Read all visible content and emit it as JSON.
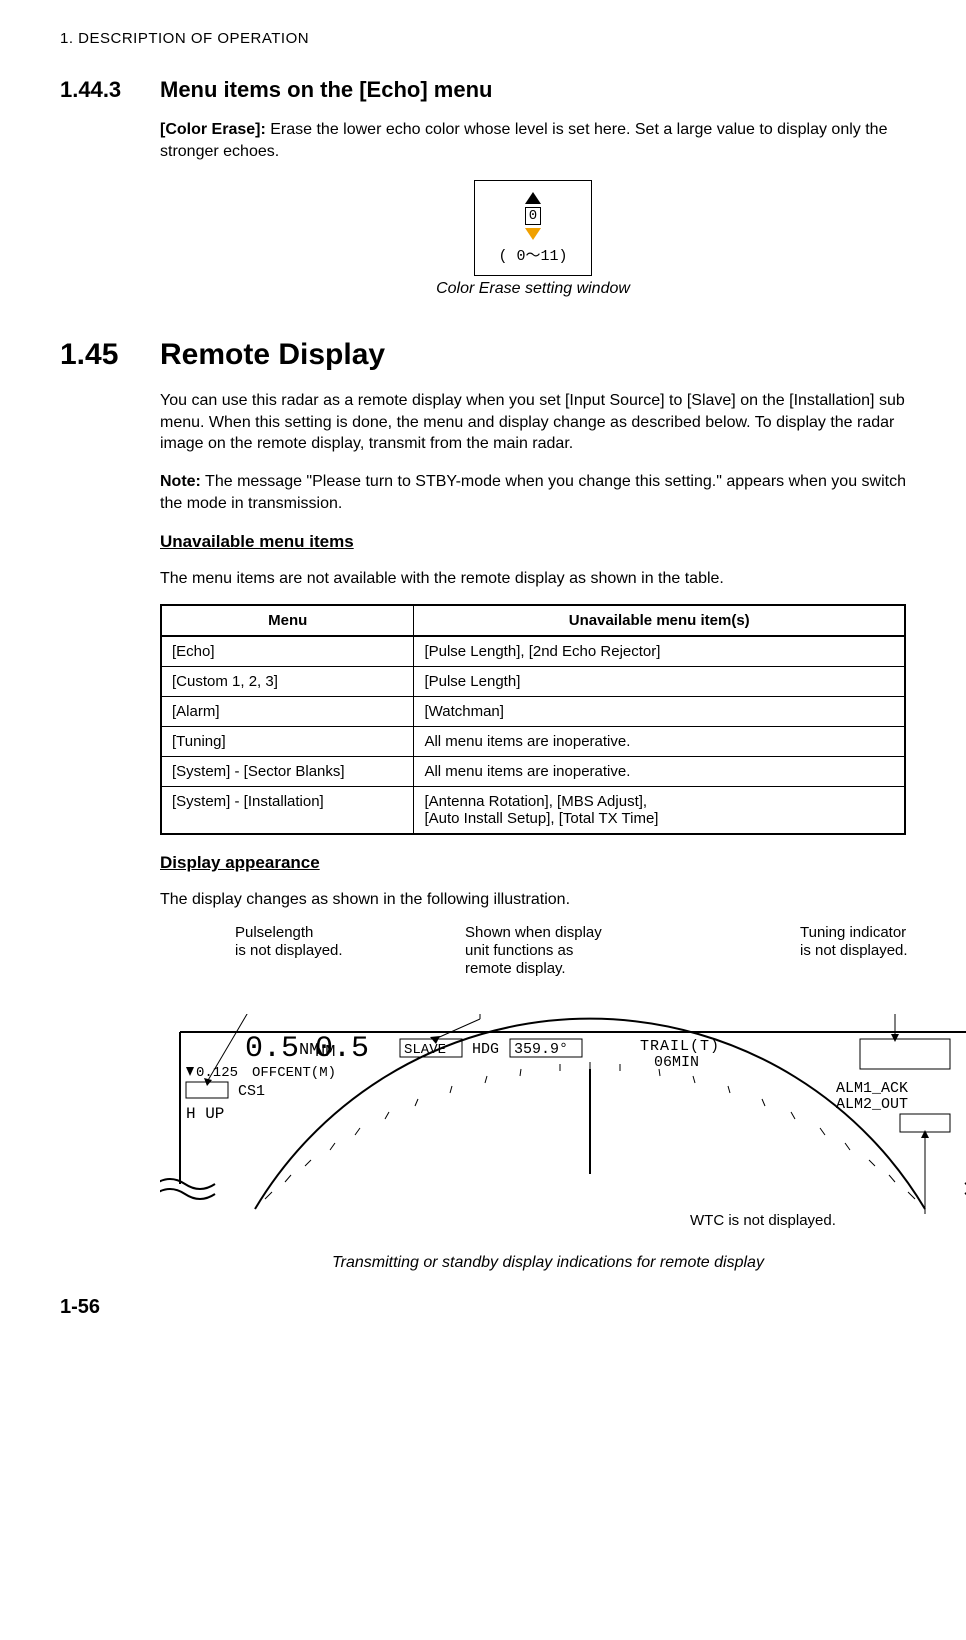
{
  "running_head": "1.  DESCRIPTION OF OPERATION",
  "sec1443": {
    "num": "1.44.3",
    "title": "Menu items on the [Echo] menu",
    "color_erase_label": "[Color Erase]:",
    "color_erase_text": " Erase the lower echo color whose level is set here. Set a large value to display only the stronger echoes.",
    "fig_zero": "0",
    "fig_range": "( 0～11)",
    "caption": "Color Erase setting window"
  },
  "sec145": {
    "num": "1.45",
    "title": "Remote Display",
    "p1": "You can use this radar as a remote display when you set [Input Source] to [Slave] on the [Installation] sub menu. When this setting is done, the menu and display change as described below. To display the radar image on the remote display, transmit from the main radar.",
    "note_label": "Note:",
    "note_text": " The message \"Please turn to STBY-mode when you change this setting.\" appears when you switch the mode in transmission.",
    "unavail_head": "Unavailable menu items",
    "unavail_intro": "The menu items are not available with the remote display as shown in the table.",
    "table": {
      "h1": "Menu",
      "h2": "Unavailable menu item(s)",
      "rows": [
        {
          "menu": "[Echo]",
          "items": "[Pulse Length], [2nd Echo Rejector]"
        },
        {
          "menu": "[Custom 1, 2, 3]",
          "items": "[Pulse Length]"
        },
        {
          "menu": "[Alarm]",
          "items": "[Watchman]"
        },
        {
          "menu": "[Tuning]",
          "items": "All menu items are inoperative."
        },
        {
          "menu": "[System] - [Sector Blanks]",
          "items": "All menu items are inoperative."
        },
        {
          "menu": "[System] - [Installation]",
          "items": "[Antenna Rotation], [MBS Adjust],\n[Auto Install Setup], [Total TX Time]"
        }
      ]
    },
    "disp_head": "Display appearance",
    "disp_intro": "The display changes as shown in the following illustration.",
    "annot": {
      "pulselength1": "Pulselength",
      "pulselength2": "is not displayed.",
      "shown1": "Shown when display",
      "shown2": "unit functions as",
      "shown3": "remote display.",
      "tuning1": "Tuning indicator",
      "tuning2": "is not displayed.",
      "wtc": "WTC is not displayed."
    },
    "radar": {
      "range_val": "0.5",
      "range_unit": "NM",
      "ring": "0.125",
      "offcent": "OFFCENT(M)",
      "cs1": "CS1",
      "hup": "H UP",
      "slave": "SLAVE",
      "hdg_label": "HDG",
      "hdg_val": "359.9°",
      "trail": "TRAIL(T)",
      "trail_time": "06MIN",
      "alm1": "ALM1_ACK",
      "alm2": "ALM2_OUT"
    },
    "caption2": "Transmitting or standby display indications for remote display"
  },
  "page_num": "1-56",
  "chart_data": {
    "type": "table",
    "title": "Unavailable menu items (remote display)",
    "columns": [
      "Menu",
      "Unavailable menu item(s)"
    ],
    "rows": [
      [
        "[Echo]",
        "[Pulse Length], [2nd Echo Rejector]"
      ],
      [
        "[Custom 1, 2, 3]",
        "[Pulse Length]"
      ],
      [
        "[Alarm]",
        "[Watchman]"
      ],
      [
        "[Tuning]",
        "All menu items are inoperative."
      ],
      [
        "[System] - [Sector Blanks]",
        "All menu items are inoperative."
      ],
      [
        "[System] - [Installation]",
        "[Antenna Rotation], [MBS Adjust], [Auto Install Setup], [Total TX Time]"
      ]
    ]
  }
}
